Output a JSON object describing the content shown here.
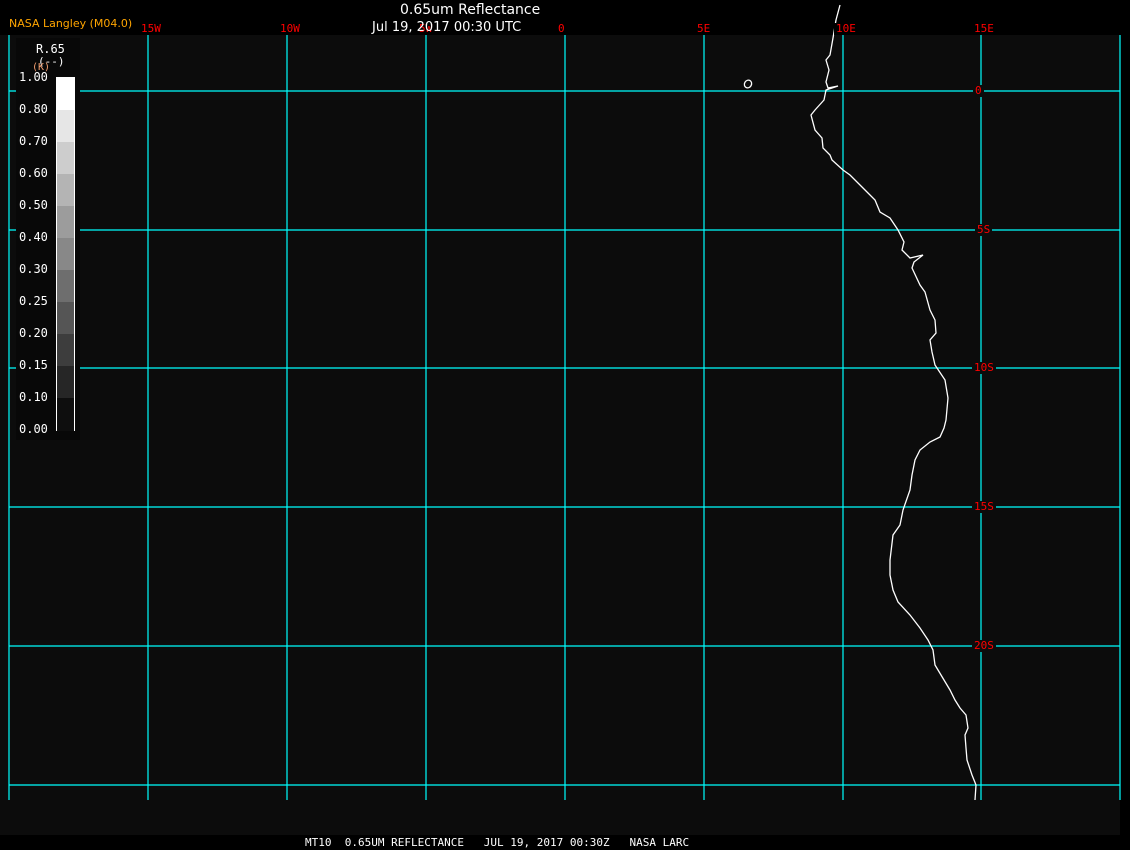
{
  "header": {
    "brand": "NASA Langley (M04.0)",
    "title": "0.65um Reflectance",
    "subtitle": "Jul 19, 2017 00:30 UTC"
  },
  "map": {
    "grid_color": "#00ffff",
    "label_color": "#ff0000",
    "coastline_color": "#ffffff",
    "longitude_labels": [
      "15W",
      "10W",
      "5W",
      "0",
      "5E",
      "10E",
      "15E"
    ],
    "latitude_labels": [
      "0",
      "5S",
      "10S",
      "15S",
      "20S"
    ]
  },
  "colorbar": {
    "variable": "R.65",
    "units": "(--)",
    "units_overlay": "(K)",
    "labels": [
      "1.00",
      "0.80",
      "0.70",
      "0.60",
      "0.50",
      "0.40",
      "0.30",
      "0.25",
      "0.20",
      "0.15",
      "0.10",
      "0.00"
    ],
    "colors": [
      "#ffffff",
      "#e6e6e6",
      "#cdcdcd",
      "#b4b4b4",
      "#9c9c9c",
      "#888888",
      "#6e6e6e",
      "#555555",
      "#3d3d3d",
      "#262626",
      "#0e0e0e"
    ]
  },
  "footer": {
    "text": "MT10  0.65UM REFLECTANCE   JUL 19, 2017 00:30Z   NASA LARC"
  }
}
